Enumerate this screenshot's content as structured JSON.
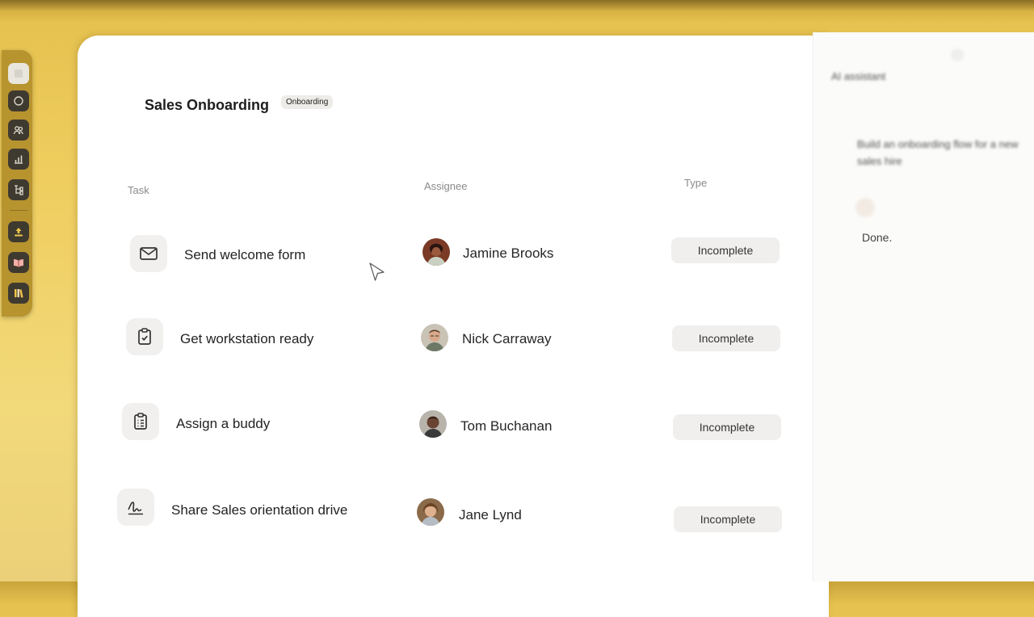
{
  "page": {
    "title": "Sales Onboarding",
    "badge": "Onboarding"
  },
  "columns": {
    "task": "Task",
    "assignee": "Assignee",
    "type": "Type"
  },
  "rows": [
    {
      "task": "Send welcome form",
      "icon": "envelope-icon",
      "assignee": "Jamine Brooks",
      "status": "Incomplete"
    },
    {
      "task": "Get workstation ready",
      "icon": "clipboard-check-icon",
      "assignee": "Nick Carraway",
      "status": "Incomplete"
    },
    {
      "task": "Assign a buddy",
      "icon": "clipboard-list-icon",
      "assignee": "Tom Buchanan",
      "status": "Incomplete"
    },
    {
      "task": "Share Sales orientation drive",
      "icon": "signature-icon",
      "assignee": "Jane Lynd",
      "status": "Incomplete"
    }
  ],
  "assistant": {
    "title": "AI assistant",
    "message": "Build an onboarding flow for a new sales hire",
    "reply": "Done."
  },
  "rail": {
    "icons": [
      "home-icon",
      "globe-icon",
      "team-icon",
      "chart-icon",
      "org-icon",
      "upload-icon",
      "book-icon",
      "library-icon"
    ]
  },
  "colors": {
    "background": "#efcd5e",
    "card": "#ffffff",
    "status_pill": "#f0efed",
    "icon_tile": "#f1f0ee"
  }
}
